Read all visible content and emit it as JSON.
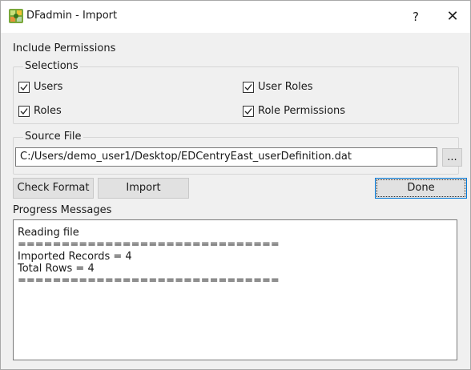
{
  "window": {
    "title": "DFadmin - Import",
    "help_label": "?",
    "close_label": "✕"
  },
  "permissions": {
    "heading": "Include Permissions",
    "selections_label": "Selections",
    "items": [
      {
        "label": "Users",
        "checked": true
      },
      {
        "label": "User Roles",
        "checked": true
      },
      {
        "label": "Roles",
        "checked": true
      },
      {
        "label": "Role Permissions",
        "checked": true
      }
    ]
  },
  "source_file": {
    "label": "Source File",
    "value": "C:/Users/demo_user1/Desktop/EDCentryEast_userDefinition.dat",
    "browse_label": "..."
  },
  "buttons": {
    "check_format": "Check Format",
    "import": "Import",
    "done": "Done"
  },
  "progress": {
    "label": "Progress Messages",
    "lines": [
      "Reading file",
      "==============================",
      "Imported Records = 4",
      "Total Rows = 4",
      "=============================="
    ]
  },
  "colors": {
    "default_button_border": "#0078d7",
    "window_background": "#f0f0f0"
  },
  "icons": {
    "app": "dfadmin-app-icon",
    "help": "help-icon",
    "close": "close-icon",
    "check": "checkmark-icon"
  }
}
